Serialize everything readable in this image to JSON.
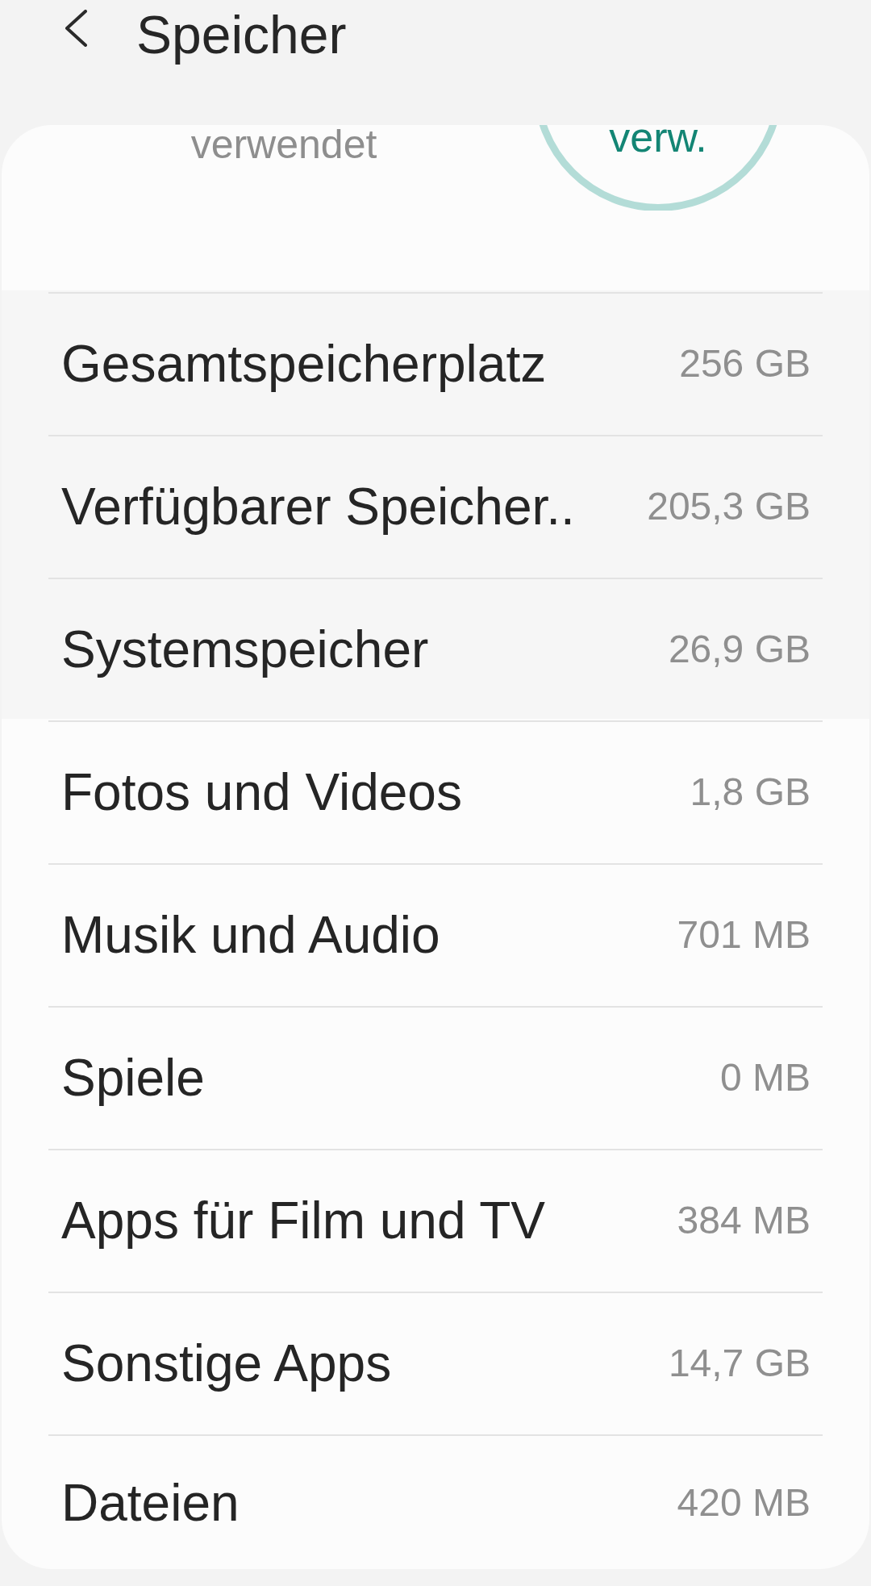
{
  "header": {
    "title": "Speicher"
  },
  "summary": {
    "used_caption": "verwendet",
    "ring_label": "verw."
  },
  "capacity_rows": [
    {
      "label": "Gesamtspeicherplatz",
      "value": "256 GB"
    },
    {
      "label": "Verfügbarer Speicher..",
      "value": "205,3 GB"
    },
    {
      "label": "Systemspeicher",
      "value": "26,9 GB"
    }
  ],
  "category_rows": [
    {
      "label": "Fotos und Videos",
      "value": "1,8 GB"
    },
    {
      "label": "Musik und Audio",
      "value": "701 MB"
    },
    {
      "label": "Spiele",
      "value": "0 MB"
    },
    {
      "label": "Apps für Film und TV",
      "value": "384 MB"
    },
    {
      "label": "Sonstige Apps",
      "value": "14,7 GB"
    },
    {
      "label": "Dateien",
      "value": "420 MB"
    }
  ]
}
